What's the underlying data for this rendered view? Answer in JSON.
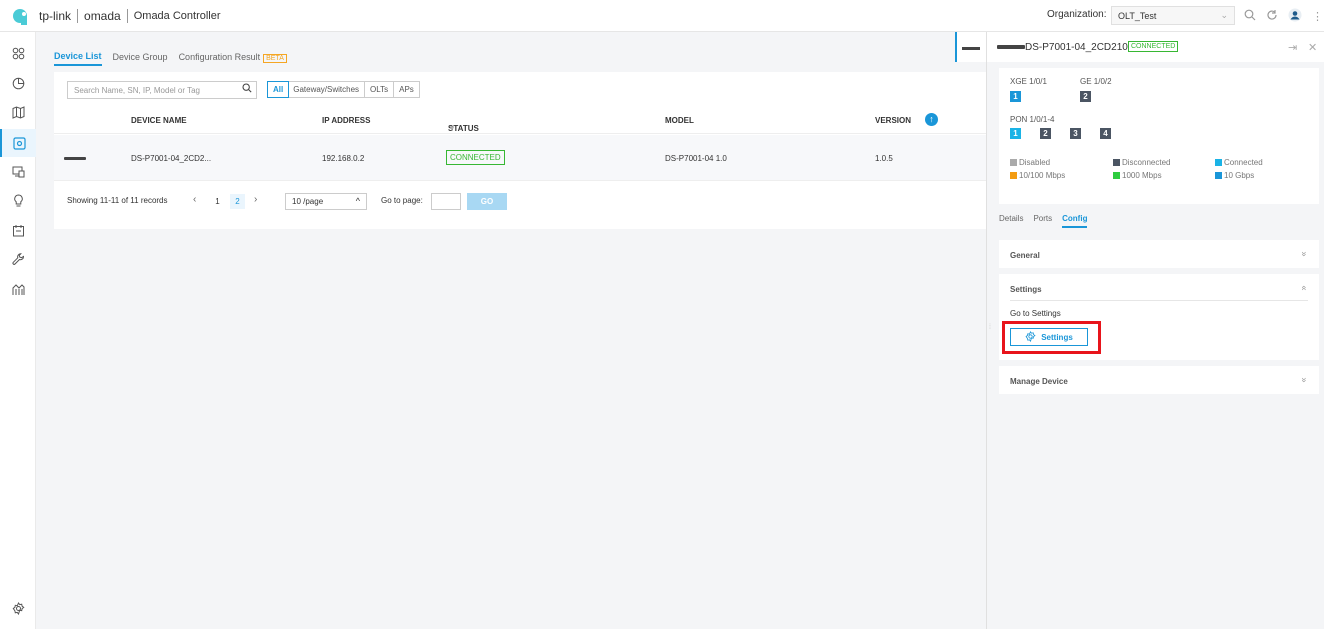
{
  "topbar": {
    "brand": "tp-link",
    "product": "omada",
    "app_title": "Omada Controller",
    "org_label": "Organization:",
    "org_value": "OLT_Test"
  },
  "icons": {
    "brand_logo": "tp-link-logo-icon",
    "search": "search-icon",
    "refresh": "refresh-icon",
    "user": "user-icon",
    "more": "more-vertical-icon"
  },
  "colors": {
    "accent": "#1a96d8",
    "connected": "#37b733",
    "beta": "#f5a623",
    "highlight": "#e8141b"
  },
  "main_tabs": [
    {
      "label": "Device List"
    },
    {
      "label": "Device Group"
    },
    {
      "label": "Configuration Result"
    }
  ],
  "beta_badge": "BETA",
  "search": {
    "placeholder": "Search Name, SN, IP, Model or Tag"
  },
  "filters": [
    "All",
    "Gateway/Switches",
    "OLTs",
    "APs"
  ],
  "table": {
    "headers": [
      "DEVICE NAME",
      "IP ADDRESS",
      "STATUS",
      "MODEL",
      "VERSION"
    ],
    "rows": [
      {
        "name": "DS-P7001-04_2CD2...",
        "ip": "192.168.0.2",
        "status": "CONNECTED",
        "model": "DS-P7001-04 1.0",
        "version": "1.0.5"
      }
    ]
  },
  "pager": {
    "records": "Showing 11-11 of 11 records",
    "pages": [
      "1",
      "2"
    ],
    "per_page": "10 /page",
    "goto_label": "Go to page:",
    "go_button": "GO"
  },
  "panel": {
    "device_name": "DS-P7001-04_2CD210",
    "status": "CONNECTED",
    "xge_label": "XGE 1/0/1",
    "ge_label": "GE 1/0/2",
    "xge_port": "1",
    "ge_port": "2",
    "pon_label": "PON 1/0/1-4",
    "pon_ports": [
      "1",
      "2",
      "3",
      "4"
    ],
    "legend": [
      {
        "label": "Disabled",
        "color": "#aaaaaa"
      },
      {
        "label": "Disconnected",
        "color": "#4b5563"
      },
      {
        "label": "Connected",
        "color": "#1ab3e6"
      },
      {
        "label": "10/100 Mbps",
        "color": "#f39c12"
      },
      {
        "label": "1000 Mbps",
        "color": "#2ecc40"
      },
      {
        "label": "10 Gbps",
        "color": "#1a96d8"
      }
    ],
    "tabs": [
      "Details",
      "Ports",
      "Config"
    ],
    "sections": {
      "general": "General",
      "settings": "Settings",
      "goto_settings": "Go to Settings",
      "settings_button": "Settings",
      "manage": "Manage Device"
    }
  }
}
